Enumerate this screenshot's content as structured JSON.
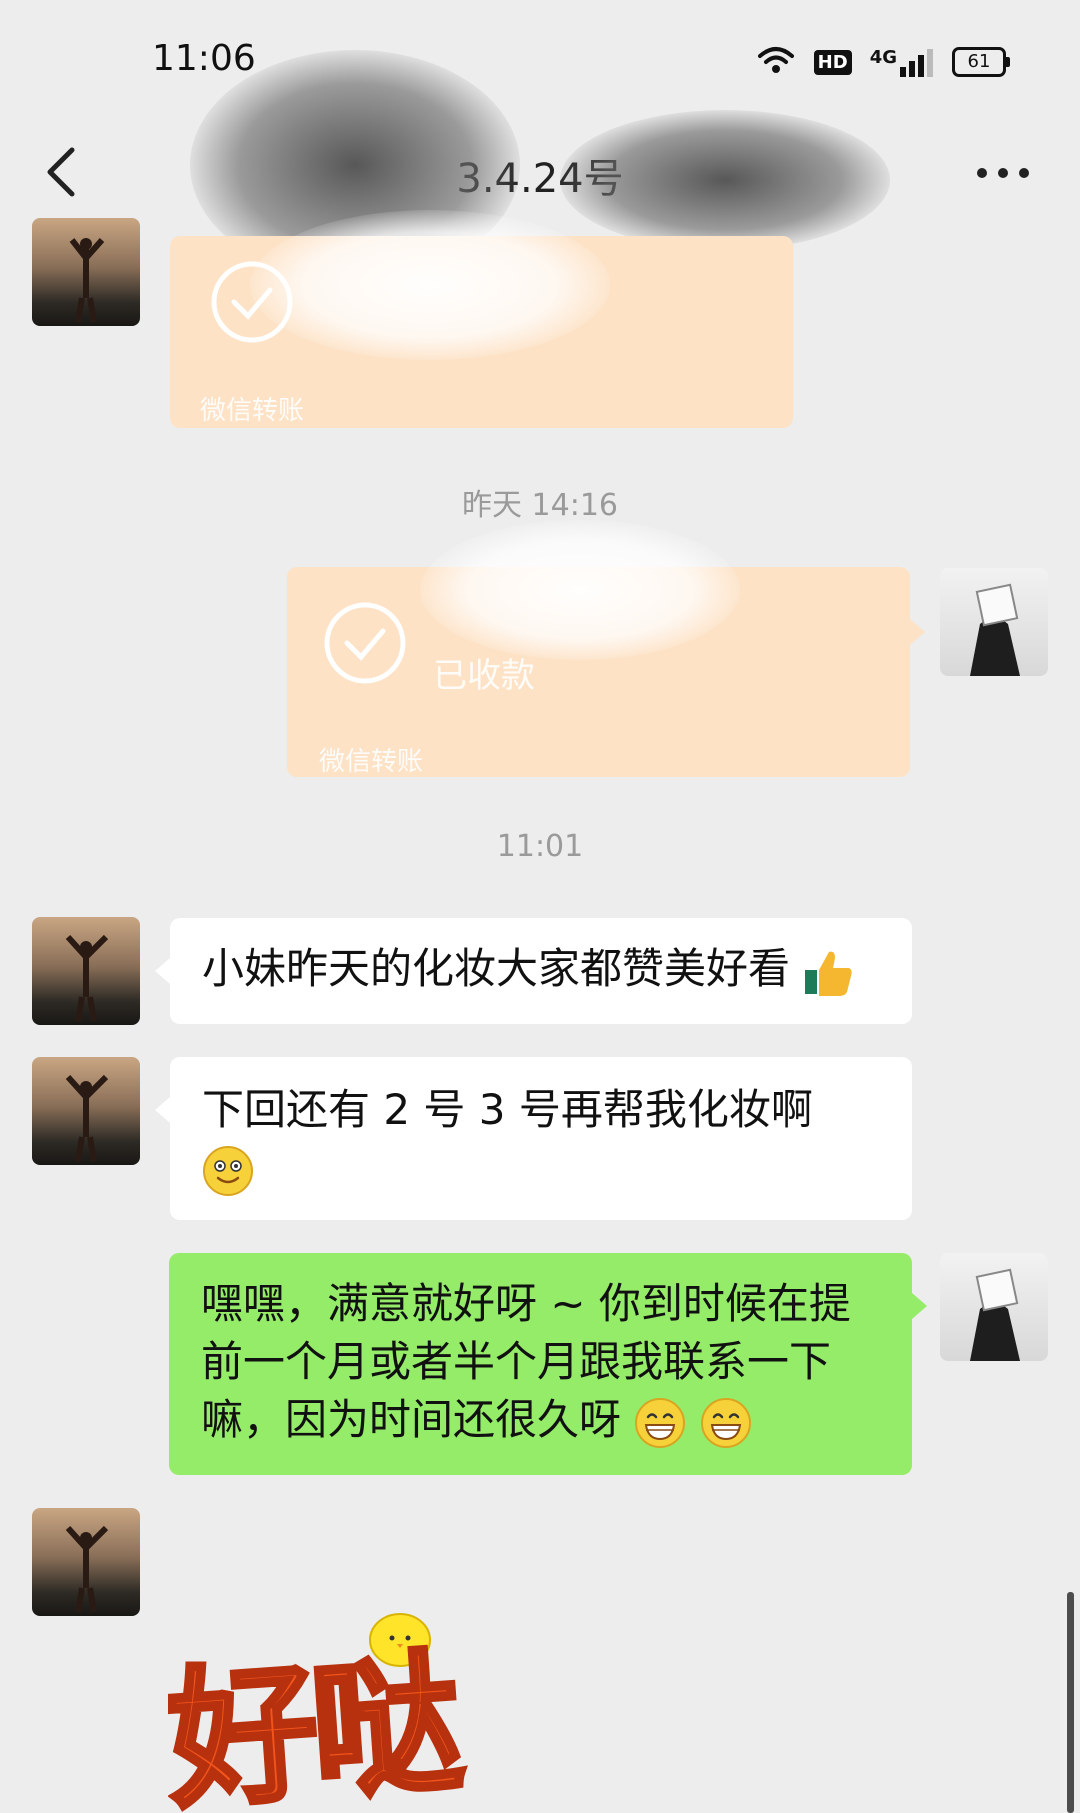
{
  "status_bar": {
    "time": "11:06",
    "hd_label": "HD",
    "network_label": "4G",
    "battery_level": "61"
  },
  "header": {
    "title": "3.4.24号",
    "back_icon": "chevron-left-icon",
    "more_icon": "more-dots-icon"
  },
  "messages": [
    {
      "type": "transfer",
      "sender": "contact",
      "status": "",
      "footer": "微信转账",
      "check_icon": "check-circle-icon"
    },
    {
      "type": "timestamp",
      "text": "昨天 14:16"
    },
    {
      "type": "transfer",
      "sender": "self",
      "status": "已收款",
      "footer": "微信转账",
      "check_icon": "check-circle-icon"
    },
    {
      "type": "timestamp",
      "text": "11:01"
    },
    {
      "type": "text",
      "sender": "contact",
      "text": "小妹昨天的化妆大家都赞美好看",
      "emoji": "thumbs-up-icon"
    },
    {
      "type": "text",
      "sender": "contact",
      "text": "下回还有 2 号 3 号再帮我化妆啊",
      "emoji": "smile-face-icon"
    },
    {
      "type": "text",
      "sender": "self",
      "text": "嘿嘿，满意就好呀 ~ 你到时候在提前一个月或者半个月跟我联系一下嘛，因为时间还很久呀",
      "emoji": "grin-face-icon"
    },
    {
      "type": "sticker",
      "sender": "contact",
      "text": "好哒",
      "icon": "chick-icon"
    }
  ],
  "colors": {
    "background": "#ededed",
    "self_bubble": "#95ec69",
    "contact_bubble": "#ffffff",
    "transfer_bubble": "#fde2c6",
    "sticker_text": "#f2541b"
  }
}
